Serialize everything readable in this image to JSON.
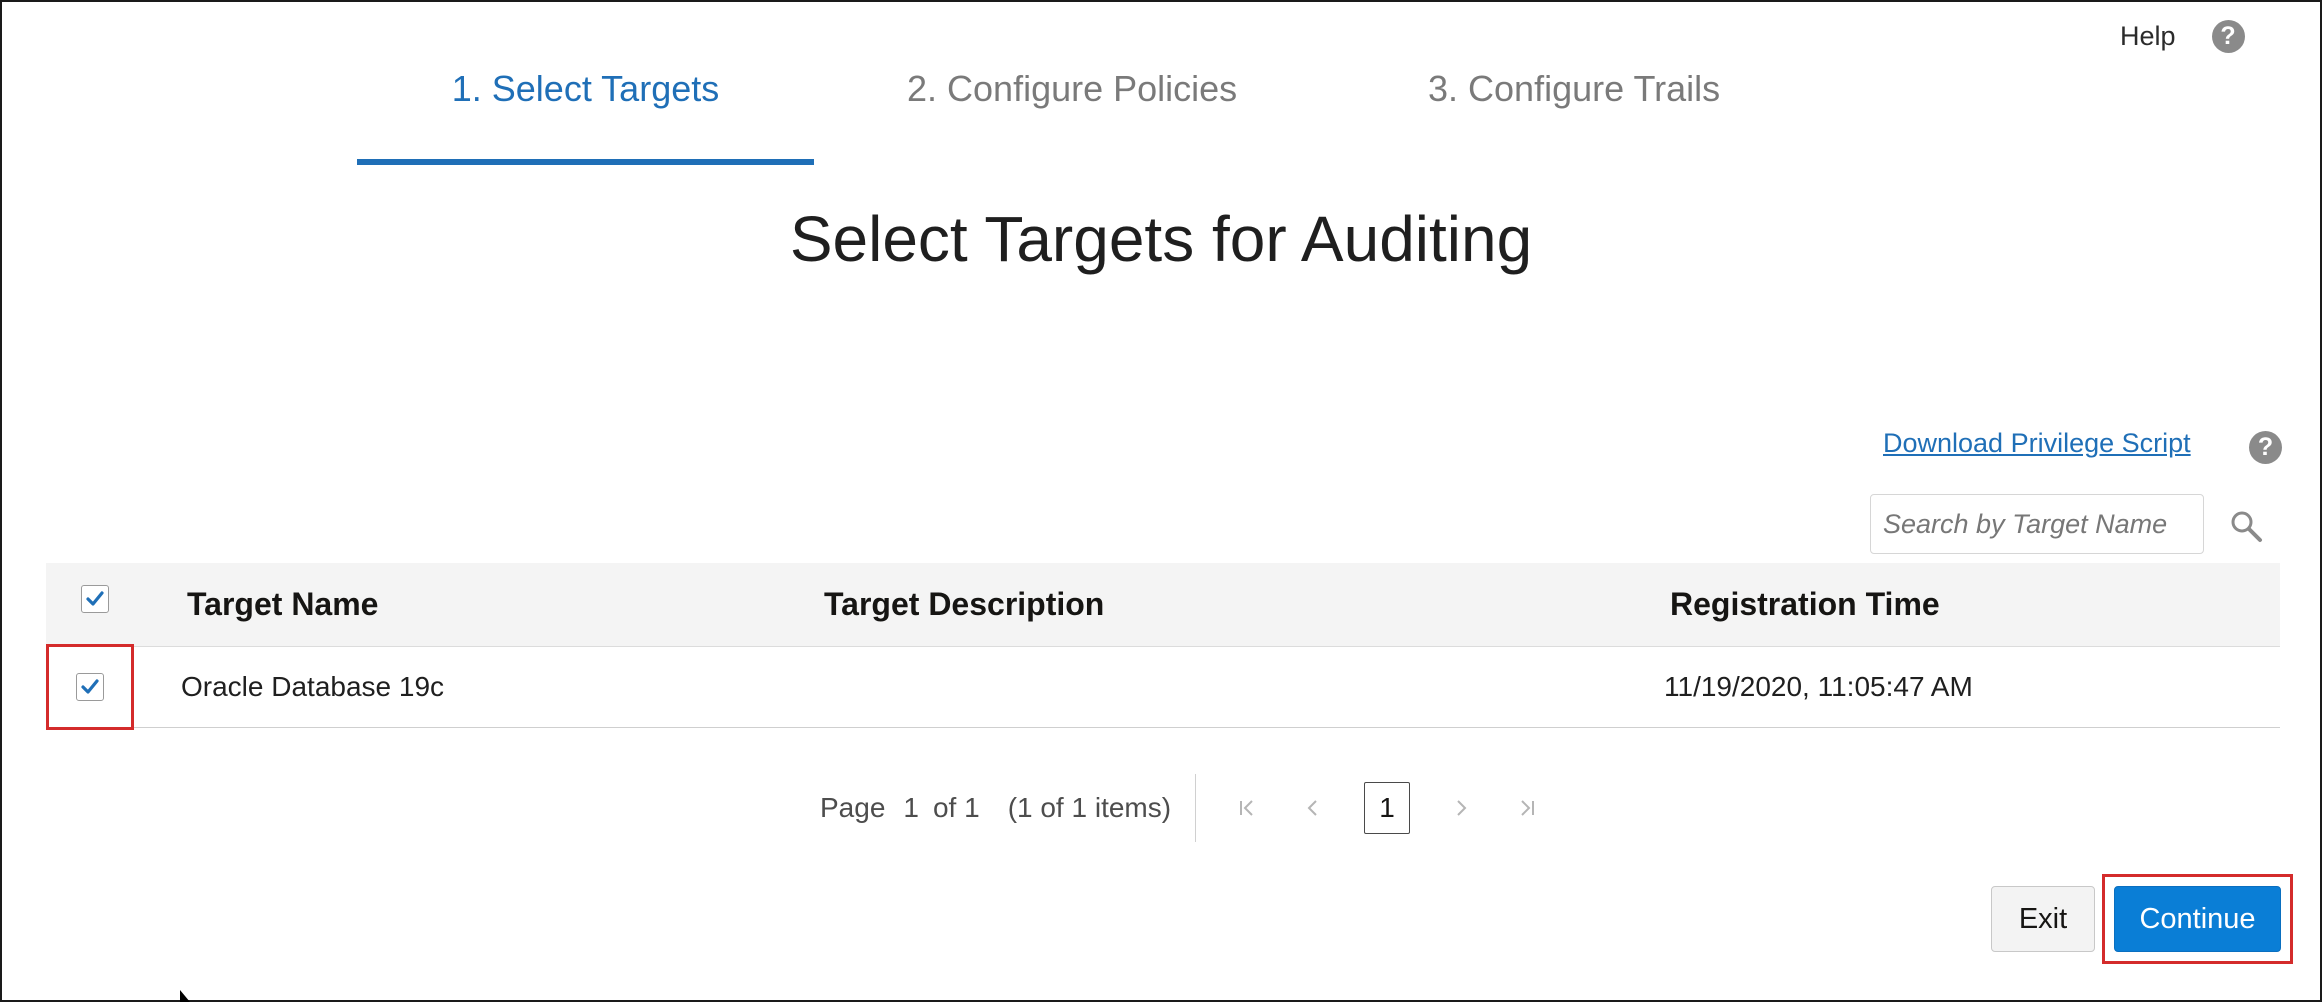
{
  "header": {
    "help_label": "Help",
    "help_icon": "question-circle-icon"
  },
  "train": {
    "steps": [
      {
        "label": "1. Select Targets",
        "state": "active"
      },
      {
        "label": "2. Configure Policies",
        "state": "inactive"
      },
      {
        "label": "3. Configure Trails",
        "state": "inactive"
      }
    ]
  },
  "page": {
    "title": "Select Targets for Auditing",
    "download_link": "Download Privilege Script"
  },
  "search": {
    "placeholder": "Search by Target Name",
    "value": ""
  },
  "table": {
    "columns": [
      "Target Name",
      "Target Description",
      "Registration Time"
    ],
    "select_all_checked": true,
    "rows": [
      {
        "checked": true,
        "name": "Oracle Database 19c",
        "description": "",
        "registration_time": "11/19/2020, 11:05:47 AM"
      }
    ]
  },
  "pagination": {
    "page_label": "Page",
    "current_page": "1",
    "of_total": "of 1",
    "items_summary": "(1 of 1 items)",
    "page_button": "1"
  },
  "actions": {
    "exit_label": "Exit",
    "continue_label": "Continue"
  },
  "colors": {
    "accent": "#1f6fb7",
    "primary_button": "#0a7ed6",
    "highlight": "#d42b2b"
  }
}
